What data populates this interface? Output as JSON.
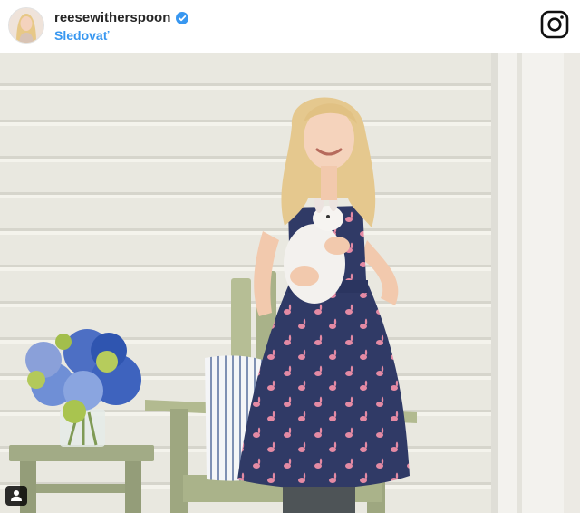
{
  "post": {
    "username": "reesewitherspoon",
    "follow_label": "Sledovať",
    "verified_icon": "verified-badge-icon",
    "brand_icon": "instagram-icon",
    "tag_icon": "user-tag-icon",
    "colors": {
      "follow": "#3897f0",
      "verified": "#3897f0",
      "username": "#262626"
    }
  }
}
